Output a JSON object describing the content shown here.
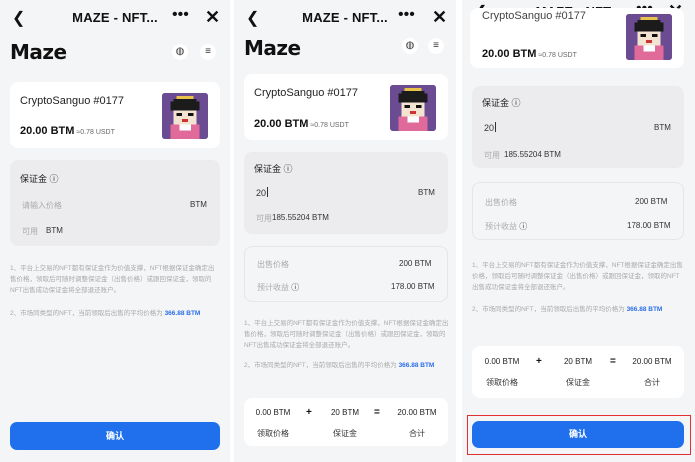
{
  "common": {
    "title": "MAZE - NFT...",
    "logo": "Maze",
    "nft_name": "CryptoSanguo #0177",
    "price": "20.00 BTM",
    "price_usdt": "≈0.78 USDT",
    "deposit_label": "保证金",
    "deposit_placeholder": "请输入价格",
    "deposit_value": "20",
    "unit": "BTM",
    "available_label": "可用",
    "available_empty": "BTM",
    "available_value": "185.55204 BTM",
    "sale_price_label": "出售价格",
    "sale_price_value": "200 BTM",
    "expected_income_label": "预计收益",
    "expected_income_value": "178.00 BTM",
    "note1": "1、平台上交易的NFT都有保证金作为价值支撑，NFT根据保证金确定出售价格，领取后可随时调整保证金（出售价格）或跟回保证金，领取的NFT出售成功保证金将全部退还账户。",
    "note2_prefix": "2、市场同类型的NFT，当前领取后出售的平均价格为",
    "note2_link": "366.88 BTM",
    "calc": {
      "receive_value": "0.00 BTM",
      "receive_label": "领取价格",
      "deposit_value": "20 BTM",
      "deposit_label": "保证金",
      "total_value": "20.00 BTM",
      "total_label": "合计",
      "plus": "+",
      "equals": "="
    },
    "confirm": "确认",
    "icons": {
      "back": "‹",
      "more": "•••",
      "close": "✕",
      "info": "ⓘ",
      "menu": "≡",
      "globe": "⊕"
    }
  }
}
